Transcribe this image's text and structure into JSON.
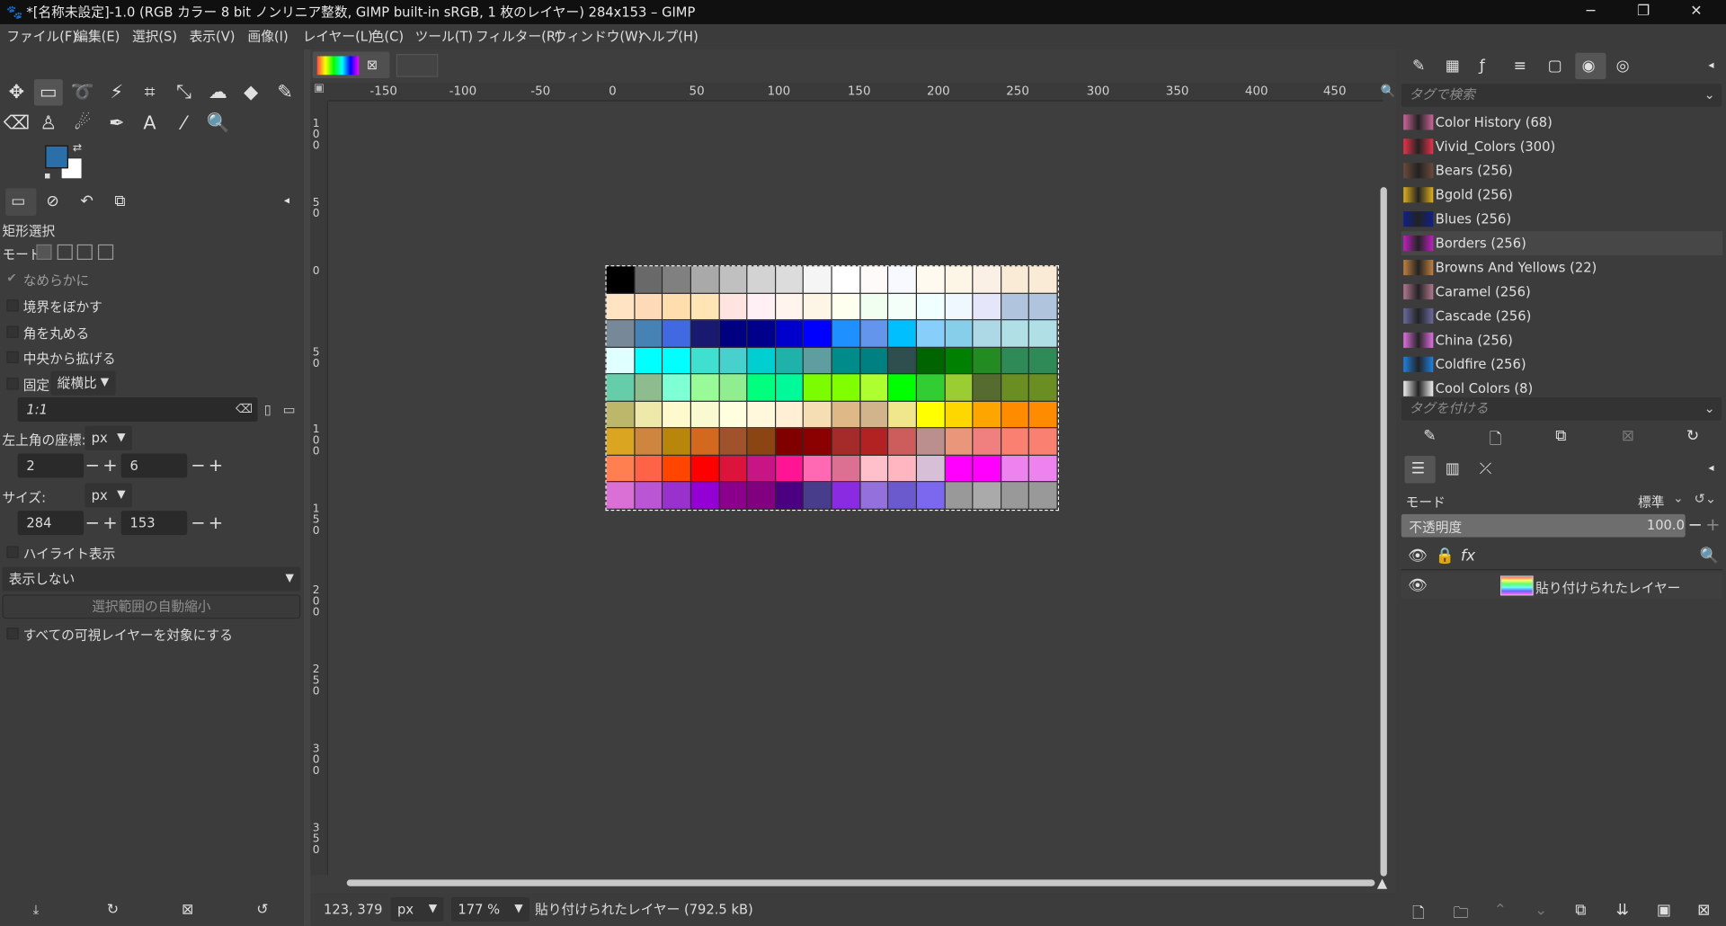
{
  "window": {
    "title": "*[名称未設定]-1.0 (RGB カラー 8 bit ノンリニア整数, GIMP built-in sRGB, 1 枚のレイヤー) 284x153 – GIMP",
    "min": "─",
    "max": "❐",
    "close": "✕"
  },
  "menu": [
    "ファイル(F)",
    "編集(E)",
    "選択(S)",
    "表示(V)",
    "画像(I)",
    "レイヤー(L)",
    "色(C)",
    "ツール(T)",
    "フィルター(R)",
    "ウィンドウ(W)",
    "ヘルプ(H)"
  ],
  "tool_options": {
    "title": "矩形選択",
    "mode_label": "モード:",
    "antialias": "なめらかに",
    "feather": "境界をぼかす",
    "rounded": "角を丸める",
    "expand_center": "中央から拡げる",
    "fixed": "固定",
    "fixed_kind": "縦横比",
    "ratio": "1:1",
    "position_label": "左上角の座標:",
    "position_unit": "px",
    "pos_x": "2",
    "pos_y": "6",
    "size_label": "サイズ:",
    "size_unit": "px",
    "size_w": "284",
    "size_h": "153",
    "highlight": "ハイライト表示",
    "guides": "表示しない",
    "autoshrink": "選択範囲の自動縮小",
    "all_layers": "すべての可視レイヤーを対象にする",
    "plus": "+",
    "minus": "−"
  },
  "ruler_h": [
    "-150",
    "-100",
    "-50",
    "0",
    "50",
    "100",
    "150",
    "200",
    "250",
    "300",
    "350",
    "400",
    "450"
  ],
  "ruler_v": [
    "1 0 0",
    "5 0",
    "0",
    "5 0",
    "1 0 0",
    "1 5 0",
    "2 0 0",
    "2 5 0",
    "3 0 0",
    "3 5 0"
  ],
  "palette_colors": [
    [
      "#000000",
      "#696969",
      "#808080",
      "#a9a9a9",
      "#c0c0c0",
      "#d3d3d3",
      "#dcdcdc",
      "#f5f5f5",
      "#ffffff",
      "#fffafa",
      "#f8f8ff",
      "#fffaf0",
      "#fdf5e6",
      "#faf0e6",
      "#faebd7"
    ],
    [
      "#ffe4c4",
      "#ffdab9",
      "#ffdead",
      "#ffe4b5",
      "#ffe4e1",
      "#fff0f5",
      "#fff5ee",
      "#fdf5e6",
      "#fffff0",
      "#f0fff0",
      "#f5fffa",
      "#f0ffff",
      "#f0f8ff",
      "#e6e6fa",
      "#b0c4de"
    ],
    [
      "#778899",
      "#4682b4",
      "#4169e1",
      "#191970",
      "#000080",
      "#00008b",
      "#0000cd",
      "#0000ff",
      "#1e90ff",
      "#6495ed",
      "#00bfff",
      "#87cefa",
      "#87ceeb",
      "#add8e6",
      "#b0e0e6"
    ],
    [
      "#e0ffff",
      "#00ffff",
      "#00ffff",
      "#40e0d0",
      "#48d1cc",
      "#00ced1",
      "#20b2aa",
      "#5f9ea0",
      "#008b8b",
      "#008080",
      "#2f4f4f",
      "#006400",
      "#008000",
      "#228b22",
      "#2e8b57"
    ],
    [
      "#66cdaa",
      "#8fbc8f",
      "#7fffd4",
      "#98fb98",
      "#90ee90",
      "#00ff7f",
      "#00fa9a",
      "#7cfc00",
      "#7fff00",
      "#adff2f",
      "#00ff00",
      "#32cd32",
      "#9acd32",
      "#556b2f",
      "#6b8e23"
    ],
    [
      "#bdb76b",
      "#eee8aa",
      "#fffacd",
      "#fafad2",
      "#ffffe0",
      "#fff8dc",
      "#ffefd5",
      "#f5deb3",
      "#deb887",
      "#d2b48c",
      "#f0e68c",
      "#ffff00",
      "#ffd700",
      "#ffa500",
      "#ff8c00"
    ],
    [
      "#daa520",
      "#cd853f",
      "#b8860b",
      "#d2691e",
      "#a0522d",
      "#8b4513",
      "#800000",
      "#8b0000",
      "#a52a2a",
      "#b22222",
      "#cd5c5c",
      "#bc8f8f",
      "#e9967a",
      "#f08080",
      "#fa8072"
    ],
    [
      "#ff7f50",
      "#ff6347",
      "#ff4500",
      "#ff0000",
      "#dc143c",
      "#c71585",
      "#ff1493",
      "#ff69b4",
      "#db7093",
      "#ffc0cb",
      "#ffb6c1",
      "#d8bfd8",
      "#ff00ff",
      "#ff00ff",
      "#ee82ee"
    ],
    [
      "#da70d6",
      "#ba55d3",
      "#9932cc",
      "#9400d3",
      "#8b008b",
      "#800080",
      "#4b0082",
      "#483d8b",
      "#8a2be2",
      "#9370db",
      "#6a5acd",
      "#7b68ee",
      "#999999",
      "#aaaaaa",
      "#999999"
    ]
  ],
  "right": {
    "tag_search": "タグで検索",
    "palettes": [
      {
        "name": "Color History (68)",
        "swatch": "#cc6699"
      },
      {
        "name": "Vivid_Colors (300)",
        "swatch": "#e8334a"
      },
      {
        "name": "Bears (256)",
        "swatch": "#6b4a3a"
      },
      {
        "name": "Bgold (256)",
        "swatch": "#e0b020"
      },
      {
        "name": "Blues (256)",
        "swatch": "#10208a"
      },
      {
        "name": "Borders (256)",
        "swatch": "#c020c0"
      },
      {
        "name": "Browns And Yellows (22)",
        "swatch": "#c08040"
      },
      {
        "name": "Caramel (256)",
        "swatch": "#b07890"
      },
      {
        "name": "Cascade (256)",
        "swatch": "#6a6aa0"
      },
      {
        "name": "China (256)",
        "swatch": "#e070e0"
      },
      {
        "name": "Coldfire (256)",
        "swatch": "#2080e0"
      },
      {
        "name": "Cool Colors (8)",
        "swatch": "#f0f0f0"
      }
    ],
    "tag_assign": "タグを付ける",
    "mode_label": "モード",
    "mode_value": "標準",
    "opacity_label": "不透明度",
    "opacity_value": "100.0",
    "layer_name": "貼り付けられたレイヤー",
    "fx": "fx"
  },
  "status": {
    "coords": "123, 379",
    "unit": "px",
    "zoom": "177 %",
    "info": "貼り付けられたレイヤー (792.5 kB)"
  }
}
